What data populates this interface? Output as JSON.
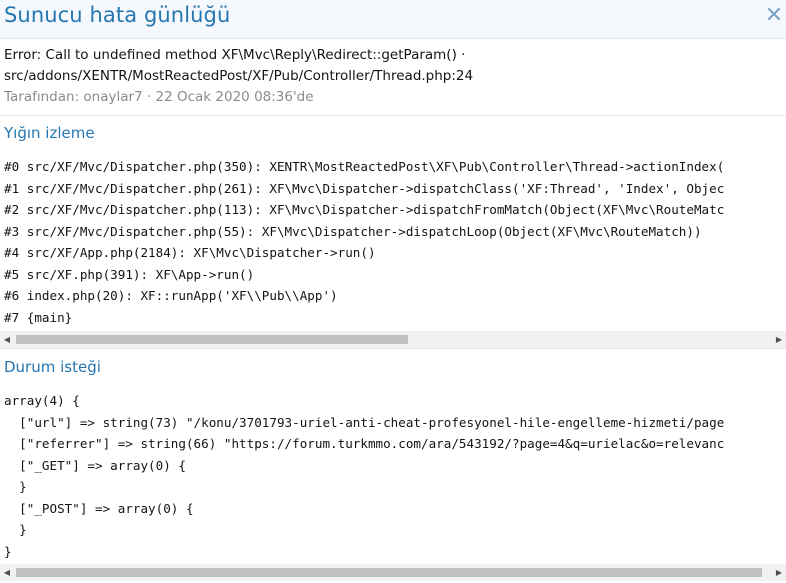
{
  "dialog": {
    "title": "Sunucu hata günlüğü",
    "close_icon": "close-icon"
  },
  "error": {
    "message": "Error: Call to undefined method XF\\Mvc\\Reply\\Redirect::getParam() ·",
    "location": "src/addons/XENTR/MostReactedPost/XF/Pub/Controller/Thread.php:24",
    "meta": "Tarafından: onaylar7 · 22 Ocak 2020 08:36'de"
  },
  "stack_trace": {
    "heading": "Yığın izleme",
    "lines": [
      "#0 src/XF/Mvc/Dispatcher.php(350): XENTR\\MostReactedPost\\XF\\Pub\\Controller\\Thread->actionIndex(",
      "#1 src/XF/Mvc/Dispatcher.php(261): XF\\Mvc\\Dispatcher->dispatchClass('XF:Thread', 'Index', Objec",
      "#2 src/XF/Mvc/Dispatcher.php(113): XF\\Mvc\\Dispatcher->dispatchFromMatch(Object(XF\\Mvc\\RouteMatc",
      "#3 src/XF/Mvc/Dispatcher.php(55): XF\\Mvc\\Dispatcher->dispatchLoop(Object(XF\\Mvc\\RouteMatch))",
      "#4 src/XF/App.php(2184): XF\\Mvc\\Dispatcher->run()",
      "#5 src/XF.php(391): XF\\App->run()",
      "#6 index.php(20): XF::runApp('XF\\\\Pub\\\\App')",
      "#7 {main}"
    ]
  },
  "request_state": {
    "heading": "Durum isteği",
    "lines": [
      "array(4) {",
      "  [\"url\"] => string(73) \"/konu/3701793-uriel-anti-cheat-profesyonel-hile-engelleme-hizmeti/page",
      "  [\"referrer\"] => string(66) \"https://forum.turkmmo.com/ara/543192/?page=4&q=urielac&o=relevanc",
      "  [\"_GET\"] => array(0) {",
      "  }",
      "  [\"_POST\"] => array(0) {",
      "  }",
      "}"
    ]
  },
  "scrollbars": {
    "left_arrow": "◀",
    "right_arrow": "▶",
    "stack_thumb_fraction": 0.52,
    "request_thumb_fraction": 0.99
  },
  "colors": {
    "accent": "#2577b1",
    "header_bg": "#f5f9fd",
    "meta_text": "#8c8c8c"
  }
}
